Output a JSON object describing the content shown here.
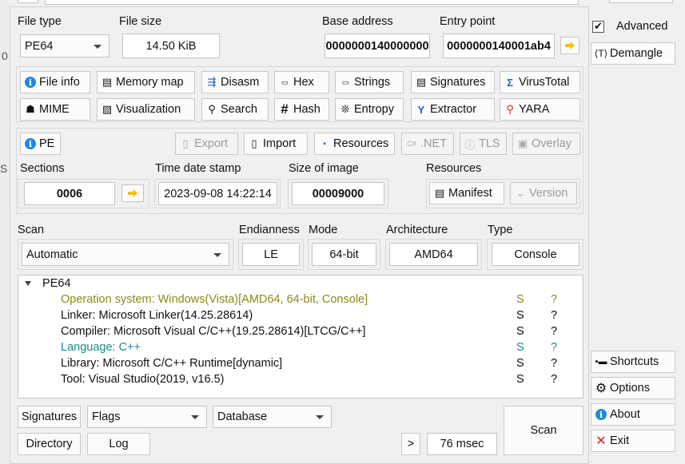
{
  "header": {
    "file_type_label": "File type",
    "file_type_value": "PE64",
    "file_size_label": "File size",
    "file_size_value": "14.50 KiB",
    "base_address_label": "Base address",
    "base_address_value": "0000000140000000",
    "entry_point_label": "Entry point",
    "entry_point_value": "0000000140001ab4"
  },
  "tools": [
    {
      "label": "File info",
      "icon": "info-icon"
    },
    {
      "label": "Memory map",
      "icon": "memory-icon"
    },
    {
      "label": "Disasm",
      "icon": "disasm-icon"
    },
    {
      "label": "Hex",
      "icon": "hex-icon"
    },
    {
      "label": "Strings",
      "icon": "strings-icon"
    },
    {
      "label": "Signatures",
      "icon": "signatures-icon"
    },
    {
      "label": "VirusTotal",
      "icon": "virustotal-icon"
    },
    {
      "label": "MIME",
      "icon": "mime-icon"
    },
    {
      "label": "Visualization",
      "icon": "visualization-icon"
    },
    {
      "label": "Search",
      "icon": "search-icon"
    },
    {
      "label": "Hash",
      "icon": "hash-icon"
    },
    {
      "label": "Entropy",
      "icon": "entropy-icon"
    },
    {
      "label": "Extractor",
      "icon": "extractor-icon"
    },
    {
      "label": "YARA",
      "icon": "yara-icon"
    }
  ],
  "pe_section": {
    "pe_button": "PE",
    "export_button": "Export",
    "import_button": "Import",
    "resources_button": "Resources",
    "net_button": ".NET",
    "tls_button": "TLS",
    "overlay_button": "Overlay",
    "sections_label": "Sections",
    "sections_value": "0006",
    "time_date_stamp_label": "Time date stamp",
    "time_date_stamp_value": "2023-09-08 14:22:14",
    "size_of_image_label": "Size of image",
    "size_of_image_value": "00009000",
    "resources_label": "Resources",
    "manifest_button": "Manifest",
    "version_button": "Version"
  },
  "scan_options": {
    "scan_label": "Scan",
    "scan_value": "Automatic",
    "endianness_label": "Endianness",
    "endianness_value": "LE",
    "mode_label": "Mode",
    "mode_value": "64-bit",
    "architecture_label": "Architecture",
    "architecture_value": "AMD64",
    "type_label": "Type",
    "type_value": "Console"
  },
  "results": {
    "root": "PE64",
    "rows": [
      {
        "text": "Operation system: Windows(Vista)[AMD64, 64-bit, Console]",
        "s": "S",
        "q": "?",
        "color": "#8a8a1a"
      },
      {
        "text": "Linker: Microsoft Linker(14.25.28614)",
        "s": "S",
        "q": "?",
        "color": "#111111"
      },
      {
        "text": "Compiler: Microsoft Visual C/C++(19.25.28614)[LTCG/C++]",
        "s": "S",
        "q": "?",
        "color": "#111111"
      },
      {
        "text": "Language: C++",
        "s": "S",
        "q": "?",
        "color": "#1a8a8a"
      },
      {
        "text": "Library: Microsoft C/C++ Runtime[dynamic]",
        "s": "S",
        "q": "?",
        "color": "#111111"
      },
      {
        "text": "Tool: Visual Studio(2019, v16.5)",
        "s": "S",
        "q": "?",
        "color": "#111111"
      }
    ]
  },
  "bottom": {
    "signatures_button": "Signatures",
    "flags_value": "Flags",
    "database_value": "Database",
    "directory_button": "Directory",
    "log_button": "Log",
    "more_button": ">",
    "time_value": "76 msec",
    "scan_button": "Scan"
  },
  "side": {
    "advanced_label": "Advanced",
    "demangle_button": "Demangle",
    "shortcuts_button": "Shortcuts",
    "options_button": "Options",
    "about_button": "About",
    "exit_button": "Exit"
  }
}
